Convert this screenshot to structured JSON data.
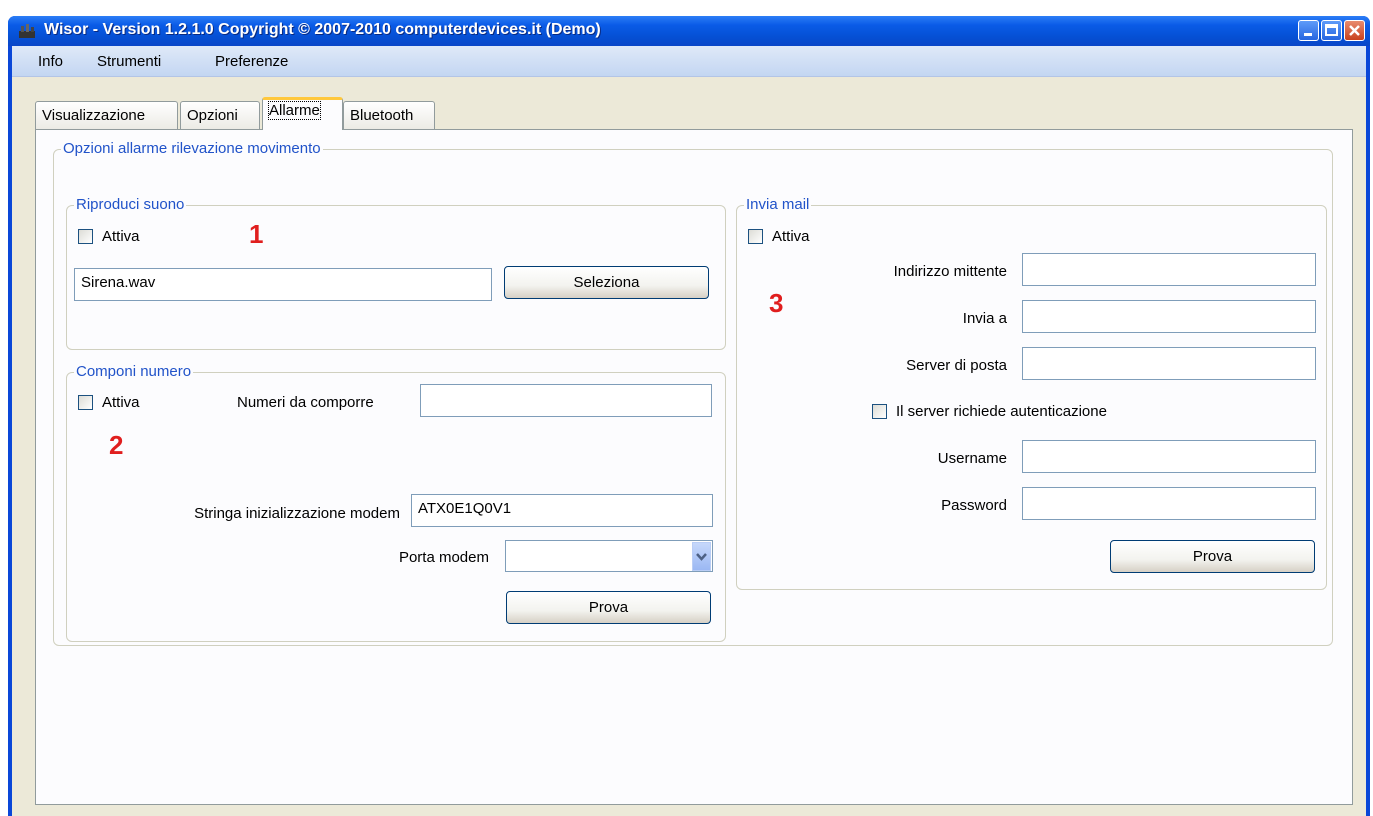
{
  "window": {
    "title": "Wisor - Version 1.2.1.0 Copyright © 2007-2010 computerdevices.it (Demo)"
  },
  "menu": {
    "info": "Info",
    "strumenti": "Strumenti",
    "preferenze": "Preferenze"
  },
  "tabs": {
    "visualizzazione": "Visualizzazione",
    "opzioni": "Opzioni",
    "allarme": "Allarme",
    "bluetooth": "Bluetooth"
  },
  "main_group": {
    "title": "Opzioni allarme rilevazione movimento"
  },
  "sound": {
    "title": "Riproduci suono",
    "attiva": "Attiva",
    "file": "Sirena.wav",
    "seleziona": "Seleziona",
    "marker": "1"
  },
  "dial": {
    "title": "Componi numero",
    "attiva": "Attiva",
    "numbers_label": "Numeri da comporre",
    "numbers_value": "",
    "modem_init_label": "Stringa inizializzazione modem",
    "modem_init_value": "ATX0E1Q0V1",
    "modem_port_label": "Porta modem",
    "modem_port_value": "",
    "prova": "Prova",
    "marker": "2"
  },
  "mail": {
    "title": "Invia mail",
    "attiva": "Attiva",
    "sender_label": "Indirizzo mittente",
    "sender_value": "",
    "to_label": "Invia a",
    "to_value": "",
    "server_label": "Server di posta",
    "server_value": "",
    "auth_label": "Il server richiede autenticazione",
    "username_label": "Username",
    "username_value": "",
    "password_label": "Password",
    "password_value": "",
    "prova": "Prova",
    "marker": "3"
  },
  "colors": {
    "title_bar": "#0a5be7",
    "group_title": "#2153c9",
    "marker": "#e01e1e",
    "active_tab_accent": "#ffc83c"
  }
}
